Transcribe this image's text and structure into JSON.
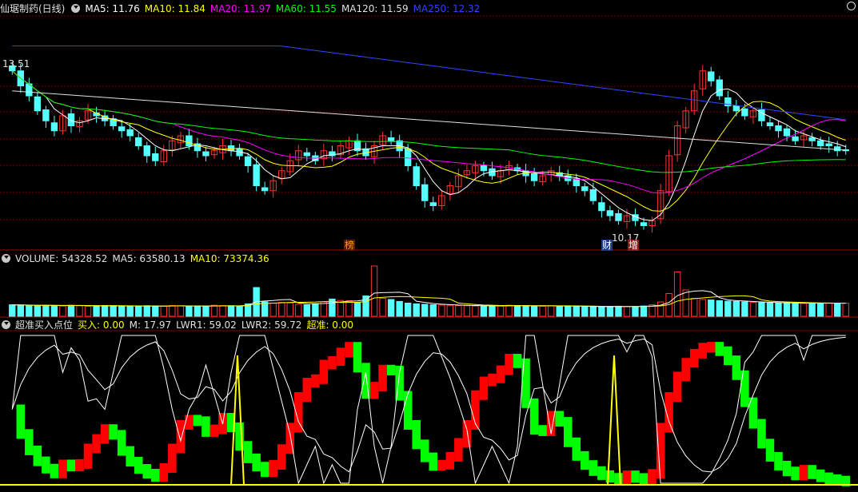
{
  "header": {
    "title": "仙琚制药(日线)",
    "ma": [
      {
        "label": "MA5: 11.76",
        "color": "#ffffff"
      },
      {
        "label": "MA10: 11.84",
        "color": "#ffff00"
      },
      {
        "label": "MA20: 11.97",
        "color": "#ff00ff"
      },
      {
        "label": "MA60: 11.55",
        "color": "#00ff00"
      },
      {
        "label": "MA120: 11.59",
        "color": "#e0e0e0"
      },
      {
        "label": "MA250: 12.32",
        "color": "#2f46ff"
      }
    ]
  },
  "volume_header": {
    "label": "VOLUME: 54328.52",
    "ma5": "MA5: 63580.13",
    "ma10": "MA10: 73374.36"
  },
  "indicator_header": {
    "name": "超准买入点位",
    "buy": "买入: 0.00",
    "m": "M: 17.97",
    "lwr1": "LWR1: 59.02",
    "lwr2": "LWR2: 59.72",
    "chaozhun": "超准: 0.00"
  },
  "annotations": {
    "high": "13.51",
    "low": "10.17",
    "tag_bang": "榜",
    "tag_cai": "财",
    "tag_zeng": "增"
  },
  "colors": {
    "up": "#ff3232",
    "down": "#54ffff",
    "ma5": "#ffffff",
    "ma10": "#ffff00",
    "ma20": "#ff00ff",
    "ma60": "#00ff00",
    "ma120": "#e0e0e0",
    "ma250": "#2f46ff",
    "grid": "#7a0000",
    "green_block": "#00ff00",
    "red_block": "#ff0000"
  },
  "chart_data": {
    "type": "candlestick",
    "symbol": "仙琚制药",
    "period": "日线",
    "price_range": [
      10.17,
      13.51
    ],
    "close": [
      13.3,
      13.0,
      12.8,
      12.5,
      12.3,
      12.1,
      12.4,
      12.2,
      12.3,
      12.5,
      12.4,
      12.3,
      12.2,
      12.1,
      12.0,
      11.8,
      11.6,
      11.5,
      11.7,
      11.9,
      12.0,
      11.8,
      11.7,
      11.6,
      11.7,
      11.8,
      11.7,
      11.6,
      11.4,
      11.0,
      10.9,
      11.1,
      11.3,
      11.5,
      11.7,
      11.6,
      11.5,
      11.7,
      11.6,
      11.8,
      11.9,
      11.7,
      11.6,
      11.8,
      12.0,
      11.9,
      11.7,
      11.4,
      11.0,
      10.7,
      10.6,
      10.8,
      11.0,
      11.2,
      11.3,
      11.4,
      11.3,
      11.2,
      11.3,
      11.4,
      11.3,
      11.2,
      11.1,
      11.2,
      11.3,
      11.2,
      11.1,
      11.0,
      10.9,
      10.7,
      10.5,
      10.4,
      10.3,
      10.4,
      10.3,
      10.2,
      10.3,
      10.9,
      11.6,
      12.2,
      12.5,
      12.9,
      13.3,
      13.1,
      12.8,
      12.6,
      12.5,
      12.4,
      12.5,
      12.3,
      12.2,
      12.1,
      12.0,
      11.9,
      12.0,
      11.9,
      11.8,
      11.8,
      11.7,
      11.7
    ],
    "volume": [
      48000,
      47000,
      45000,
      44000,
      46000,
      45000,
      43000,
      46000,
      44000,
      42000,
      43000,
      45000,
      44000,
      43000,
      42000,
      41000,
      44000,
      43000,
      42000,
      45000,
      44000,
      43000,
      42000,
      41000,
      46000,
      45000,
      44000,
      43000,
      52000,
      120000,
      60000,
      55000,
      58000,
      56000,
      50000,
      48000,
      52000,
      60000,
      72000,
      66000,
      65000,
      58000,
      85000,
      210000,
      75000,
      70000,
      62000,
      55000,
      52000,
      50000,
      48000,
      47000,
      46000,
      45000,
      44000,
      43000,
      42000,
      44000,
      43000,
      46000,
      45000,
      44000,
      43000,
      42000,
      44000,
      43000,
      42000,
      41000,
      40000,
      39000,
      40000,
      41000,
      42000,
      40000,
      41000,
      43000,
      48000,
      60000,
      95000,
      185000,
      110000,
      75000,
      70000,
      68000,
      65000,
      63000,
      62000,
      60000,
      58000,
      57000,
      56000,
      55000,
      56000,
      55000,
      54000,
      55000,
      54328.52,
      55000,
      54000,
      54328.52
    ],
    "indicators": {
      "volume_ma5": 63580.13,
      "volume_ma10": 73374.36,
      "buy": 0.0,
      "M": 17.97,
      "LWR1": 59.02,
      "LWR2": 59.72,
      "chaozhun": 0.0
    }
  }
}
